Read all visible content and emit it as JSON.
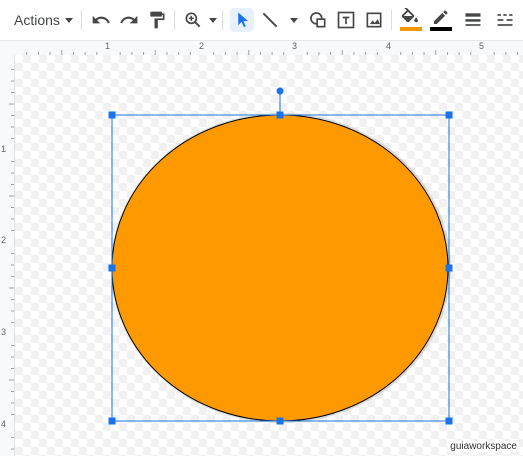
{
  "toolbar": {
    "actions_label": "Actions",
    "icons": [
      "undo-icon",
      "redo-icon",
      "paint-format-icon",
      "zoom-icon",
      "select-icon",
      "line-icon",
      "shape-icon",
      "text-box-icon",
      "image-icon",
      "fill-color-icon",
      "border-color-icon",
      "border-weight-icon"
    ],
    "fill_color": "#f29900",
    "border_color": "#000000",
    "accent": "#1a73e8"
  },
  "hruler": {
    "labels": [
      "1",
      "2",
      "3",
      "4",
      "5"
    ]
  },
  "vruler": {
    "labels": [
      "1",
      "2",
      "3",
      "4"
    ]
  },
  "shape": {
    "type": "ellipse",
    "fill": "#ff9900",
    "stroke": "#000000",
    "handle_color": "#1a73e8"
  },
  "watermark": "guiaworkspace"
}
